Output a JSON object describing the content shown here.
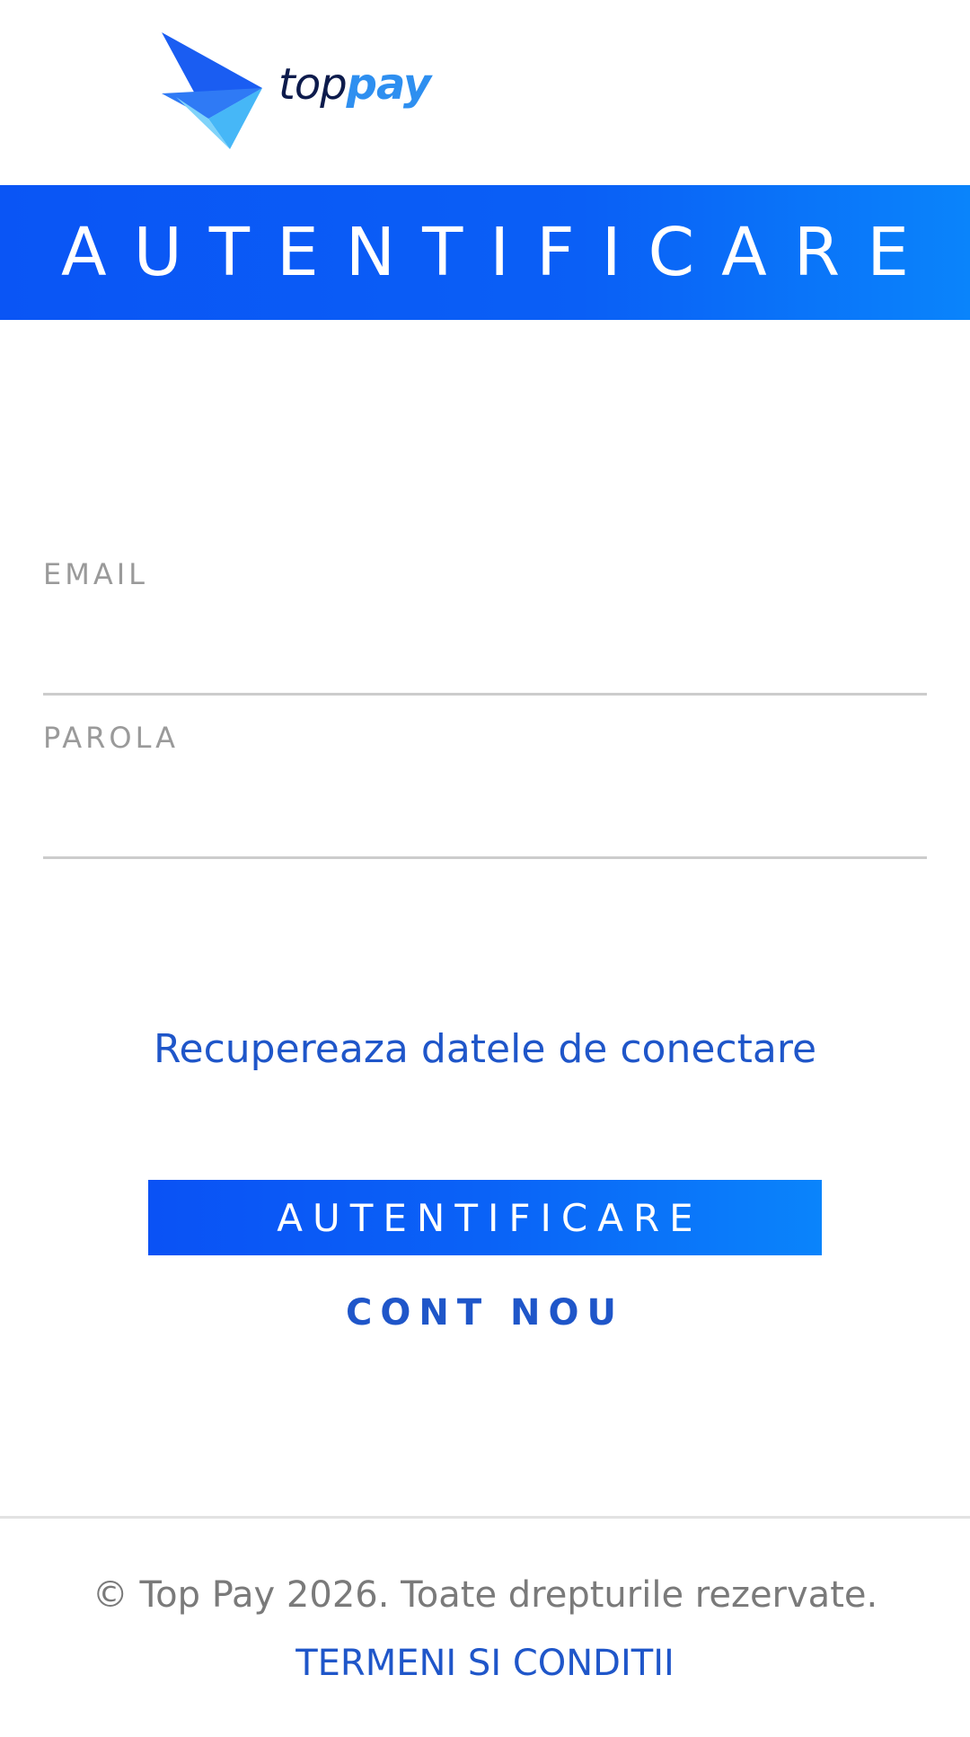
{
  "brand": {
    "name_part_1": "top",
    "name_part_2": "pay",
    "logo_icon": "paper-plane-logo",
    "colors": {
      "primary": "#0a55f5",
      "accent": "#0a84fb",
      "link": "#1f56c9",
      "logo_dark": "#0d1b4c",
      "logo_light": "#2e8ff0"
    }
  },
  "header": {
    "title": "AUTENTIFICARE"
  },
  "form": {
    "email": {
      "label": "EMAIL",
      "value": ""
    },
    "password": {
      "label": "PAROLA",
      "value": ""
    },
    "recover_link": "Recupereaza datele de conectare",
    "login_button": "AUTENTIFICARE",
    "new_account_button": "CONT NOU"
  },
  "footer": {
    "copyright": "© Top Pay 2026. Toate drepturile rezervate.",
    "terms_link": "TERMENI SI CONDITII"
  }
}
